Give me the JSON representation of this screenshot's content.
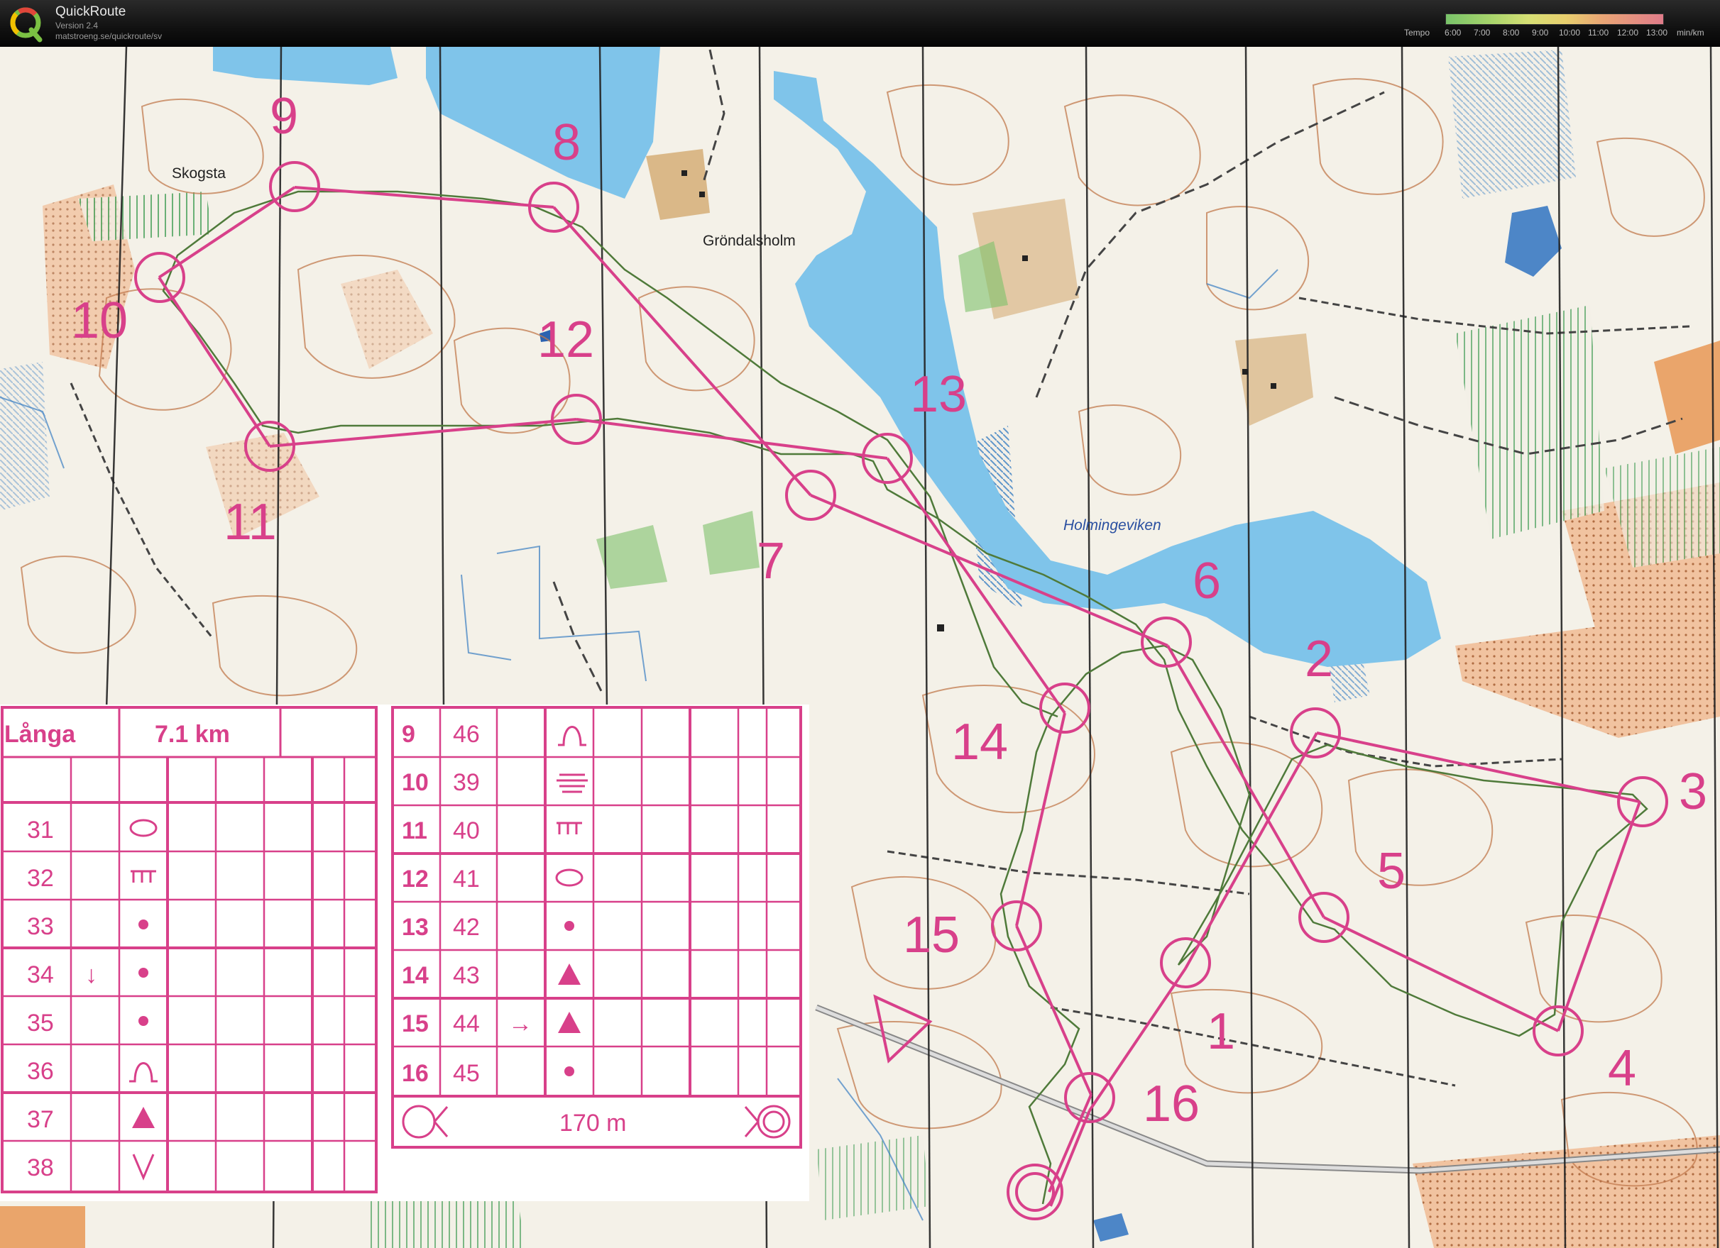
{
  "app": {
    "name": "QuickRoute",
    "version": "Version 2.4",
    "url": "matstroeng.se/quickroute/sv",
    "tempo_label": "Tempo",
    "tempo_unit": "min/km",
    "tempo_ticks": [
      "6:00",
      "7:00",
      "8:00",
      "9:00",
      "10:00",
      "11:00",
      "12:00",
      "13:00"
    ],
    "colors": {
      "course": "#d8408a",
      "water": "#7fc4ea",
      "contour": "#c27a4d",
      "route": "#4f7a3a"
    }
  },
  "map": {
    "places": {
      "skogsta": "Skogsta",
      "grondalsholm": "Gröndalsholm",
      "holmingeviken": "Holmingeviken"
    },
    "control_numbers": [
      "1",
      "2",
      "3",
      "4",
      "5",
      "6",
      "7",
      "8",
      "9",
      "10",
      "11",
      "12",
      "13",
      "14",
      "15",
      "16"
    ]
  },
  "description_sheet": {
    "course_name": "Långa",
    "length": "7.1 km",
    "left_rows": [
      {
        "code": "31",
        "direction": "",
        "symbol": "ellipse"
      },
      {
        "code": "32",
        "direction": "",
        "symbol": "comb"
      },
      {
        "code": "33",
        "direction": "",
        "symbol": "dot"
      },
      {
        "code": "34",
        "direction": "↓",
        "symbol": "dot"
      },
      {
        "code": "35",
        "direction": "",
        "symbol": "dot"
      },
      {
        "code": "36",
        "direction": "",
        "symbol": "knoll"
      },
      {
        "code": "37",
        "direction": "",
        "symbol": "triangle"
      },
      {
        "code": "38",
        "direction": "",
        "symbol": "v-shape"
      }
    ],
    "right_rows": [
      {
        "number": "9",
        "code": "46",
        "direction": "",
        "symbol": "knoll"
      },
      {
        "number": "10",
        "code": "39",
        "direction": "",
        "symbol": "marsh"
      },
      {
        "number": "11",
        "code": "40",
        "direction": "",
        "symbol": "comb"
      },
      {
        "number": "12",
        "code": "41",
        "direction": "",
        "symbol": "ellipse"
      },
      {
        "number": "13",
        "code": "42",
        "direction": "",
        "symbol": "dot"
      },
      {
        "number": "14",
        "code": "43",
        "direction": "",
        "symbol": "triangle"
      },
      {
        "number": "15",
        "code": "44",
        "direction": "→",
        "symbol": "triangle"
      },
      {
        "number": "16",
        "code": "45",
        "direction": "",
        "symbol": "dot"
      }
    ],
    "finish_distance": "170 m"
  }
}
